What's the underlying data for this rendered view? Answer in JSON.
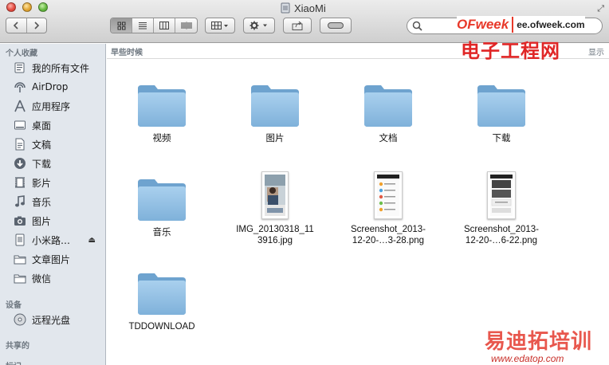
{
  "window": {
    "title": "XiaoMi",
    "toolbar": {
      "back_icon": "chevron-left-icon",
      "forward_icon": "chevron-right-icon",
      "view_modes": [
        "icon-view",
        "list-view",
        "column-view",
        "coverflow-view"
      ],
      "active_view": "icon-view",
      "arrange_icon": "arrange-grid-icon",
      "action_icon": "gear-icon",
      "share_icon": "share-icon",
      "tag_icon": "label-pill-icon",
      "search_placeholder": ""
    }
  },
  "sidebar": {
    "favorites_header": "个人收藏",
    "favorites": [
      {
        "label": "我的所有文件",
        "icon": "all-files-icon"
      },
      {
        "label": "AirDrop",
        "icon": "airdrop-icon"
      },
      {
        "label": "应用程序",
        "icon": "applications-icon"
      },
      {
        "label": "桌面",
        "icon": "desktop-icon"
      },
      {
        "label": "文稿",
        "icon": "documents-icon"
      },
      {
        "label": "下载",
        "icon": "downloads-icon"
      },
      {
        "label": "影片",
        "icon": "movies-icon"
      },
      {
        "label": "音乐",
        "icon": "music-icon"
      },
      {
        "label": "图片",
        "icon": "pictures-icon"
      },
      {
        "label": "小米路…",
        "icon": "drive-icon",
        "ejectable": true
      },
      {
        "label": "文章图片",
        "icon": "folder-icon"
      },
      {
        "label": "微信",
        "icon": "folder-icon"
      }
    ],
    "devices_header": "设备",
    "devices": [
      {
        "label": "远程光盘",
        "icon": "disc-icon"
      }
    ],
    "shared_header": "共享的",
    "tags_header": "标记"
  },
  "content": {
    "group_title": "早些时候",
    "show_all": "显示",
    "items": [
      {
        "label": "视频",
        "kind": "folder"
      },
      {
        "label": "图片",
        "kind": "folder"
      },
      {
        "label": "文档",
        "kind": "folder"
      },
      {
        "label": "下载",
        "kind": "folder"
      },
      {
        "label": "音乐",
        "kind": "folder"
      },
      {
        "label": "IMG_20130318_11\n3916.jpg",
        "kind": "photo"
      },
      {
        "label": "Screenshot_2013-\n12-20-…3-28.png",
        "kind": "phone-screenshot"
      },
      {
        "label": "Screenshot_2013-\n12-20-…6-22.png",
        "kind": "phone-screenshot-dark"
      },
      {
        "label": "TDDOWNLOAD",
        "kind": "folder"
      }
    ]
  },
  "watermarks": {
    "top_brand": "OFweek",
    "top_url": "ee.ofweek.com",
    "top_cn": "电子工程网",
    "bottom_cn": "易迪拓培训",
    "bottom_url": "www.edatop.com"
  },
  "colors": {
    "folder": "#8fbde0",
    "sidebar_bg": "#e2e7ed",
    "watermark_red": "#e8392a"
  }
}
